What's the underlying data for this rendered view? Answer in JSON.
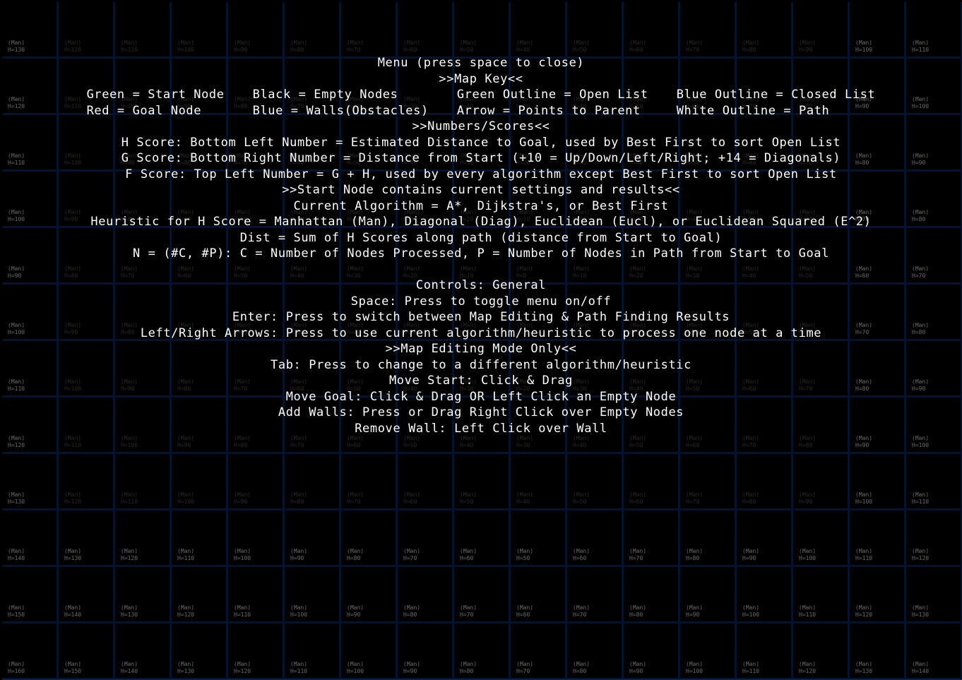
{
  "grid": {
    "heuristic_tag": "(Man)",
    "rows": [
      [
        "H=130",
        "H=120",
        "H=110",
        "H=100",
        "H=90",
        "H=80",
        "H=70",
        "H=60",
        "H=50",
        "H=40",
        "H=50",
        "H=60",
        "H=70",
        "H=80",
        "H=90",
        "H=100",
        "H=110"
      ],
      [
        "H=120",
        "H=110",
        "H=100",
        "H=90",
        "H=80",
        "H=70",
        "H=60",
        "H=50",
        "H=40",
        "H=30",
        "H=40",
        "H=50",
        "H=60",
        "H=70",
        "H=80",
        "H=90",
        "H=100"
      ],
      [
        "H=110",
        "H=100",
        "H=90",
        "H=80",
        "H=70",
        "H=60",
        "H=50",
        "H=40",
        "H=30",
        "H=20",
        "H=30",
        "H=40",
        "H=50",
        "H=60",
        "H=70",
        "H=80",
        "H=90"
      ],
      [
        "H=100",
        "H=90",
        "H=80",
        "H=70",
        "H=60",
        "H=50",
        "H=40",
        "H=30",
        "H=20",
        "H=10",
        "H=20",
        "H=30",
        "H=40",
        "H=50",
        "H=60",
        "H=70",
        "H=80"
      ],
      [
        "H=90",
        "H=80",
        "H=70",
        "H=60",
        "H=50",
        "H=40",
        "H=30",
        "H=20",
        "H=10",
        "H=0",
        "H=10",
        "H=20",
        "H=30",
        "H=40",
        "H=50",
        "H=60",
        "H=70"
      ],
      [
        "H=100",
        "H=90",
        "H=80",
        "H=70",
        "H=60",
        "H=50",
        "H=40",
        "H=30",
        "H=20",
        "H=10",
        "H=20",
        "H=30",
        "H=40",
        "H=50",
        "H=60",
        "H=70",
        "H=80"
      ],
      [
        "H=110",
        "H=100",
        "H=90",
        "H=80",
        "H=70",
        "H=60",
        "H=50",
        "H=40",
        "H=30",
        "H=20",
        "H=30",
        "H=40",
        "H=50",
        "H=60",
        "H=70",
        "H=80",
        "H=90"
      ],
      [
        "H=120",
        "H=110",
        "H=100",
        "H=90",
        "H=80",
        "H=70",
        "H=60",
        "H=50",
        "H=40",
        "H=30",
        "H=40",
        "H=50",
        "H=60",
        "H=70",
        "H=80",
        "H=90",
        "H=100"
      ],
      [
        "H=130",
        "H=120",
        "H=110",
        "H=100",
        "H=90",
        "H=80",
        "H=70",
        "H=60",
        "H=50",
        "H=40",
        "H=50",
        "H=60",
        "H=70",
        "H=80",
        "H=90",
        "H=100",
        "H=110"
      ],
      [
        "H=140",
        "H=130",
        "H=120",
        "H=110",
        "H=100",
        "H=90",
        "H=80",
        "H=70",
        "H=60",
        "H=50",
        "H=60",
        "H=70",
        "H=80",
        "H=90",
        "H=100",
        "H=110",
        "H=120"
      ],
      [
        "H=150",
        "H=140",
        "H=130",
        "H=120",
        "H=110",
        "H=100",
        "H=90",
        "H=80",
        "H=70",
        "H=60",
        "H=70",
        "H=80",
        "H=90",
        "H=100",
        "H=110",
        "H=120",
        "H=130"
      ],
      [
        "H=160",
        "H=150",
        "H=140",
        "H=130",
        "H=120",
        "H=110",
        "H=100",
        "H=90",
        "H=80",
        "H=70",
        "H=80",
        "H=90",
        "H=100",
        "H=110",
        "H=120",
        "H=130",
        "H=140"
      ]
    ]
  },
  "colors": {
    "background": "#000000",
    "grid_line": "#0d2a66",
    "start_outline": "#1f8f1f",
    "goal": "#7a1111",
    "wall": "#0c2270",
    "menu_text": "#ffffff"
  },
  "menu": {
    "title": "Menu (press space to close)",
    "map_key_header": ">>Map Key<<",
    "legend": {
      "green_start": "Green = Start Node",
      "red_goal": "Red = Goal Node",
      "black_empty": "Black = Empty Nodes",
      "blue_walls": "Blue = Walls(Obstacles)",
      "green_outline": "Green Outline = Open List",
      "arrow_parent": "Arrow = Points to Parent",
      "blue_outline": "Blue Outline = Closed List",
      "white_outline": "White Outline = Path"
    },
    "numbers_header": ">>Numbers/Scores<<",
    "h_score": "H Score: Bottom Left Number = Estimated Distance to Goal, used by Best First to sort Open List",
    "g_score": "G Score: Bottom Right Number = Distance from Start (+10 = Up/Down/Left/Right; +14 = Diagonals)",
    "f_score": "F Score: Top Left Number = G + H, used by every algorithm except Best First to sort Open List",
    "start_node_header": ">>Start Node contains current settings and results<<",
    "current_algorithm": "Current Algorithm = A*, Dijkstra's, or Best First",
    "heuristic": "Heuristic for H Score = Manhattan (Man), Diagonal (Diag), Euclidean (Eucl), or Euclidean Squared (E^2)",
    "dist": "Dist = Sum of H Scores along path (distance from Start to Goal)",
    "n_line": "N = (#C, #P): C = Number of Nodes Processed, P = Number of Nodes in Path from Start to Goal",
    "controls_general_header": "Controls: General",
    "space": "Space: Press to toggle menu on/off",
    "enter": "Enter: Press to switch between Map Editing & Path Finding Results",
    "arrows": "Left/Right Arrows: Press to use current algorithm/heuristic to process one node at a time",
    "map_editing_header": ">>Map Editing Mode Only<<",
    "tab": "Tab: Press to change to a different algorithm/heuristic",
    "move_start": "Move Start: Click & Drag",
    "move_goal": "Move Goal: Click & Drag OR Left Click an Empty Node",
    "add_walls": "Add Walls: Press or Drag Right Click over Empty Nodes",
    "remove_wall": "Remove Wall: Left Click over Wall"
  }
}
